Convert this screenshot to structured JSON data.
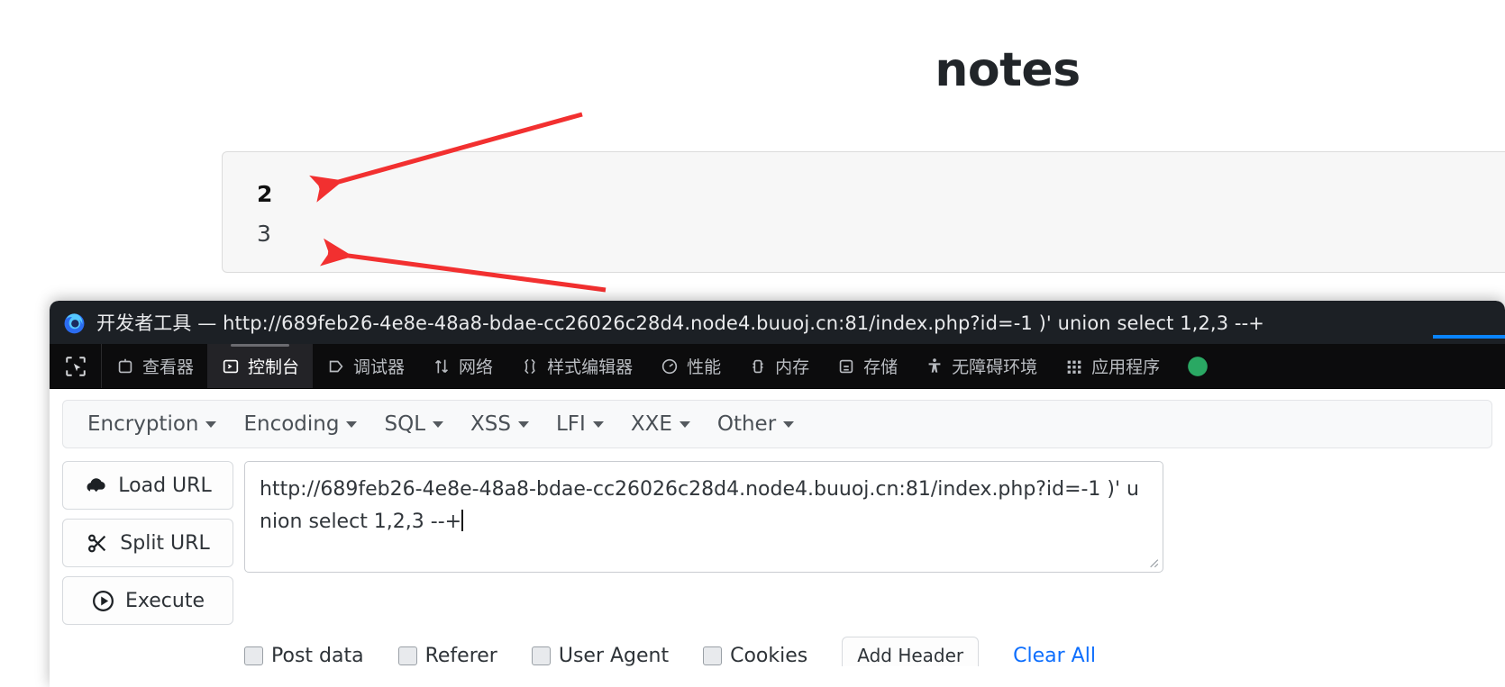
{
  "page": {
    "title": "notes",
    "notes_card": {
      "lines": [
        {
          "text": "2",
          "emphasis": "bold"
        },
        {
          "text": "3",
          "emphasis": "normal"
        }
      ]
    }
  },
  "devtools": {
    "window_title_app": "开发者工具",
    "window_title_separator": "—",
    "window_title_url": "http://689feb26-4e8e-48a8-bdae-cc26026c28d4.node4.buuoj.cn:81/index.php?id=-1 )' union select 1,2,3 --+",
    "window_title_full": "开发者工具 — http://689feb26-4e8e-48a8-bdae-cc26026c28d4.node4.buuoj.cn:81/index.php?id=-1 )' union select 1,2,3 --+",
    "firefox_logo": "firefox-logo-icon",
    "tabs": [
      {
        "label": "查看器",
        "icon": "inspector-icon",
        "active": false
      },
      {
        "label": "控制台",
        "icon": "console-icon",
        "active": true
      },
      {
        "label": "调试器",
        "icon": "debugger-icon",
        "active": false
      },
      {
        "label": "网络",
        "icon": "network-icon",
        "active": false
      },
      {
        "label": "样式编辑器",
        "icon": "style-editor-icon",
        "active": false
      },
      {
        "label": "性能",
        "icon": "performance-icon",
        "active": false
      },
      {
        "label": "内存",
        "icon": "memory-icon",
        "active": false
      },
      {
        "label": "存储",
        "icon": "storage-icon",
        "active": false
      },
      {
        "label": "无障碍环境",
        "icon": "accessibility-icon",
        "active": false
      },
      {
        "label": "应用程序",
        "icon": "application-icon",
        "active": false
      }
    ],
    "element_picker_icon": "element-picker-icon"
  },
  "hackbar": {
    "menus": [
      {
        "label": "Encryption"
      },
      {
        "label": "Encoding"
      },
      {
        "label": "SQL"
      },
      {
        "label": "XSS"
      },
      {
        "label": "LFI"
      },
      {
        "label": "XXE"
      },
      {
        "label": "Other"
      }
    ],
    "buttons": [
      {
        "label": "Load URL",
        "icon": "cloud-download-icon"
      },
      {
        "label": "Split URL",
        "icon": "scissors-icon"
      },
      {
        "label": "Execute",
        "icon": "play-icon"
      }
    ],
    "url_textarea": {
      "value": "http://689feb26-4e8e-48a8-bdae-cc26026c28d4.node4.buuoj.cn:81/index.php?id=-1 )' union select 1,2,3 --+",
      "placeholder": "http://"
    },
    "options": [
      {
        "label": "Post data",
        "checked": false
      },
      {
        "label": "Referer",
        "checked": false
      },
      {
        "label": "User Agent",
        "checked": false
      },
      {
        "label": "Cookies",
        "checked": false
      }
    ],
    "add_header_label": "Add Header",
    "clear_all_label": "Clear All"
  },
  "annotations": {
    "arrow_color": "#f23030",
    "arrows": [
      {
        "name": "arrow-to-note-2"
      },
      {
        "name": "arrow-to-note-3"
      },
      {
        "name": "arrow-to-payload-1"
      },
      {
        "name": "arrow-to-payload-2"
      }
    ]
  },
  "colors": {
    "accent_blue": "#0a84ff",
    "link_blue": "#0d6efd",
    "devtools_titlebar": "#1c2025",
    "devtools_tabbar": "#0c0c0d",
    "arrow_red": "#f23030"
  }
}
